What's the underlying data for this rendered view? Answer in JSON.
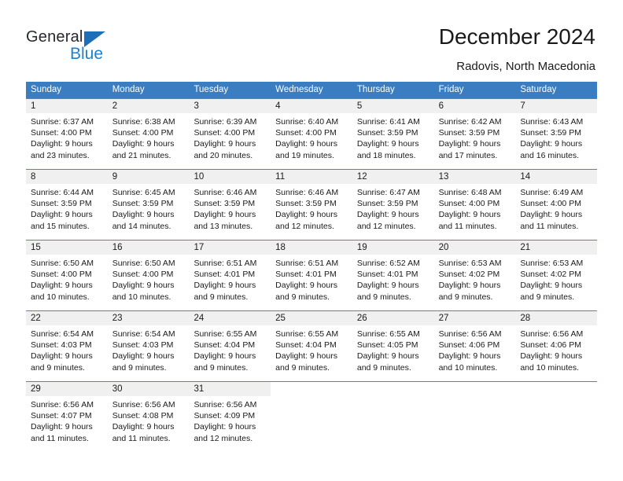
{
  "brand": {
    "name_part1": "General",
    "name_part2": "Blue",
    "color_dark": "#25282c",
    "color_blue": "#1d7fd0",
    "triangle_color": "#1d6fb8"
  },
  "header": {
    "title": "December 2024",
    "subtitle": "Radovis, North Macedonia"
  },
  "theme": {
    "header_bg": "#3a7dc0",
    "daynum_bg": "#f0f0f0",
    "row_border": "#4a86c3",
    "text": "#1a1a1a"
  },
  "weekdays": [
    "Sunday",
    "Monday",
    "Tuesday",
    "Wednesday",
    "Thursday",
    "Friday",
    "Saturday"
  ],
  "weeks": [
    [
      {
        "day": "1",
        "sunrise": "Sunrise: 6:37 AM",
        "sunset": "Sunset: 4:00 PM",
        "daylight1": "Daylight: 9 hours",
        "daylight2": "and 23 minutes."
      },
      {
        "day": "2",
        "sunrise": "Sunrise: 6:38 AM",
        "sunset": "Sunset: 4:00 PM",
        "daylight1": "Daylight: 9 hours",
        "daylight2": "and 21 minutes."
      },
      {
        "day": "3",
        "sunrise": "Sunrise: 6:39 AM",
        "sunset": "Sunset: 4:00 PM",
        "daylight1": "Daylight: 9 hours",
        "daylight2": "and 20 minutes."
      },
      {
        "day": "4",
        "sunrise": "Sunrise: 6:40 AM",
        "sunset": "Sunset: 4:00 PM",
        "daylight1": "Daylight: 9 hours",
        "daylight2": "and 19 minutes."
      },
      {
        "day": "5",
        "sunrise": "Sunrise: 6:41 AM",
        "sunset": "Sunset: 3:59 PM",
        "daylight1": "Daylight: 9 hours",
        "daylight2": "and 18 minutes."
      },
      {
        "day": "6",
        "sunrise": "Sunrise: 6:42 AM",
        "sunset": "Sunset: 3:59 PM",
        "daylight1": "Daylight: 9 hours",
        "daylight2": "and 17 minutes."
      },
      {
        "day": "7",
        "sunrise": "Sunrise: 6:43 AM",
        "sunset": "Sunset: 3:59 PM",
        "daylight1": "Daylight: 9 hours",
        "daylight2": "and 16 minutes."
      }
    ],
    [
      {
        "day": "8",
        "sunrise": "Sunrise: 6:44 AM",
        "sunset": "Sunset: 3:59 PM",
        "daylight1": "Daylight: 9 hours",
        "daylight2": "and 15 minutes."
      },
      {
        "day": "9",
        "sunrise": "Sunrise: 6:45 AM",
        "sunset": "Sunset: 3:59 PM",
        "daylight1": "Daylight: 9 hours",
        "daylight2": "and 14 minutes."
      },
      {
        "day": "10",
        "sunrise": "Sunrise: 6:46 AM",
        "sunset": "Sunset: 3:59 PM",
        "daylight1": "Daylight: 9 hours",
        "daylight2": "and 13 minutes."
      },
      {
        "day": "11",
        "sunrise": "Sunrise: 6:46 AM",
        "sunset": "Sunset: 3:59 PM",
        "daylight1": "Daylight: 9 hours",
        "daylight2": "and 12 minutes."
      },
      {
        "day": "12",
        "sunrise": "Sunrise: 6:47 AM",
        "sunset": "Sunset: 3:59 PM",
        "daylight1": "Daylight: 9 hours",
        "daylight2": "and 12 minutes."
      },
      {
        "day": "13",
        "sunrise": "Sunrise: 6:48 AM",
        "sunset": "Sunset: 4:00 PM",
        "daylight1": "Daylight: 9 hours",
        "daylight2": "and 11 minutes."
      },
      {
        "day": "14",
        "sunrise": "Sunrise: 6:49 AM",
        "sunset": "Sunset: 4:00 PM",
        "daylight1": "Daylight: 9 hours",
        "daylight2": "and 11 minutes."
      }
    ],
    [
      {
        "day": "15",
        "sunrise": "Sunrise: 6:50 AM",
        "sunset": "Sunset: 4:00 PM",
        "daylight1": "Daylight: 9 hours",
        "daylight2": "and 10 minutes."
      },
      {
        "day": "16",
        "sunrise": "Sunrise: 6:50 AM",
        "sunset": "Sunset: 4:00 PM",
        "daylight1": "Daylight: 9 hours",
        "daylight2": "and 10 minutes."
      },
      {
        "day": "17",
        "sunrise": "Sunrise: 6:51 AM",
        "sunset": "Sunset: 4:01 PM",
        "daylight1": "Daylight: 9 hours",
        "daylight2": "and 9 minutes."
      },
      {
        "day": "18",
        "sunrise": "Sunrise: 6:51 AM",
        "sunset": "Sunset: 4:01 PM",
        "daylight1": "Daylight: 9 hours",
        "daylight2": "and 9 minutes."
      },
      {
        "day": "19",
        "sunrise": "Sunrise: 6:52 AM",
        "sunset": "Sunset: 4:01 PM",
        "daylight1": "Daylight: 9 hours",
        "daylight2": "and 9 minutes."
      },
      {
        "day": "20",
        "sunrise": "Sunrise: 6:53 AM",
        "sunset": "Sunset: 4:02 PM",
        "daylight1": "Daylight: 9 hours",
        "daylight2": "and 9 minutes."
      },
      {
        "day": "21",
        "sunrise": "Sunrise: 6:53 AM",
        "sunset": "Sunset: 4:02 PM",
        "daylight1": "Daylight: 9 hours",
        "daylight2": "and 9 minutes."
      }
    ],
    [
      {
        "day": "22",
        "sunrise": "Sunrise: 6:54 AM",
        "sunset": "Sunset: 4:03 PM",
        "daylight1": "Daylight: 9 hours",
        "daylight2": "and 9 minutes."
      },
      {
        "day": "23",
        "sunrise": "Sunrise: 6:54 AM",
        "sunset": "Sunset: 4:03 PM",
        "daylight1": "Daylight: 9 hours",
        "daylight2": "and 9 minutes."
      },
      {
        "day": "24",
        "sunrise": "Sunrise: 6:55 AM",
        "sunset": "Sunset: 4:04 PM",
        "daylight1": "Daylight: 9 hours",
        "daylight2": "and 9 minutes."
      },
      {
        "day": "25",
        "sunrise": "Sunrise: 6:55 AM",
        "sunset": "Sunset: 4:04 PM",
        "daylight1": "Daylight: 9 hours",
        "daylight2": "and 9 minutes."
      },
      {
        "day": "26",
        "sunrise": "Sunrise: 6:55 AM",
        "sunset": "Sunset: 4:05 PM",
        "daylight1": "Daylight: 9 hours",
        "daylight2": "and 9 minutes."
      },
      {
        "day": "27",
        "sunrise": "Sunrise: 6:56 AM",
        "sunset": "Sunset: 4:06 PM",
        "daylight1": "Daylight: 9 hours",
        "daylight2": "and 10 minutes."
      },
      {
        "day": "28",
        "sunrise": "Sunrise: 6:56 AM",
        "sunset": "Sunset: 4:06 PM",
        "daylight1": "Daylight: 9 hours",
        "daylight2": "and 10 minutes."
      }
    ],
    [
      {
        "day": "29",
        "sunrise": "Sunrise: 6:56 AM",
        "sunset": "Sunset: 4:07 PM",
        "daylight1": "Daylight: 9 hours",
        "daylight2": "and 11 minutes."
      },
      {
        "day": "30",
        "sunrise": "Sunrise: 6:56 AM",
        "sunset": "Sunset: 4:08 PM",
        "daylight1": "Daylight: 9 hours",
        "daylight2": "and 11 minutes."
      },
      {
        "day": "31",
        "sunrise": "Sunrise: 6:56 AM",
        "sunset": "Sunset: 4:09 PM",
        "daylight1": "Daylight: 9 hours",
        "daylight2": "and 12 minutes."
      },
      {
        "day": "",
        "sunrise": "",
        "sunset": "",
        "daylight1": "",
        "daylight2": ""
      },
      {
        "day": "",
        "sunrise": "",
        "sunset": "",
        "daylight1": "",
        "daylight2": ""
      },
      {
        "day": "",
        "sunrise": "",
        "sunset": "",
        "daylight1": "",
        "daylight2": ""
      },
      {
        "day": "",
        "sunrise": "",
        "sunset": "",
        "daylight1": "",
        "daylight2": ""
      }
    ]
  ]
}
